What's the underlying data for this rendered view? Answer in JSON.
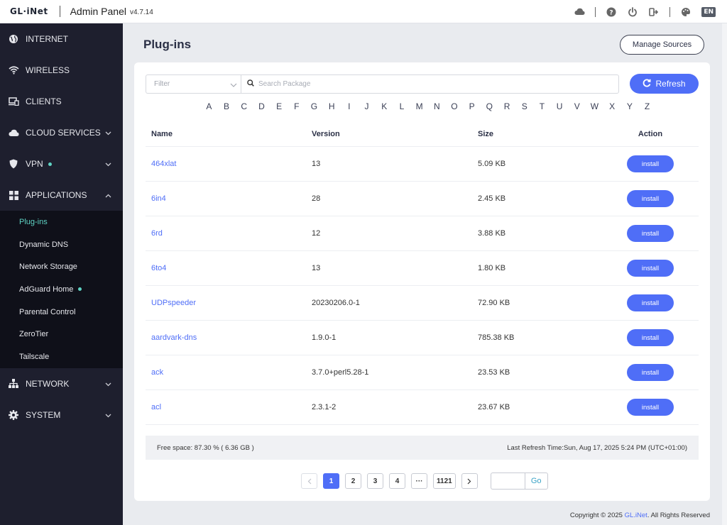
{
  "header": {
    "logo": "GL·iNet",
    "title": "Admin Panel",
    "version": "v4.7.14",
    "lang": "EN"
  },
  "sidebar": {
    "items": [
      {
        "label": "INTERNET",
        "icon": "globe-icon"
      },
      {
        "label": "WIRELESS",
        "icon": "wifi-icon"
      },
      {
        "label": "CLIENTS",
        "icon": "devices-icon"
      },
      {
        "label": "CLOUD SERVICES",
        "icon": "cloud-icon"
      },
      {
        "label": "VPN",
        "icon": "shield-icon"
      },
      {
        "label": "APPLICATIONS",
        "icon": "apps-grid-icon"
      },
      {
        "label": "NETWORK",
        "icon": "network-icon"
      },
      {
        "label": "SYSTEM",
        "icon": "gear-icon"
      }
    ],
    "sub_items": [
      {
        "label": "Plug-ins"
      },
      {
        "label": "Dynamic DNS"
      },
      {
        "label": "Network Storage"
      },
      {
        "label": "AdGuard Home"
      },
      {
        "label": "Parental Control"
      },
      {
        "label": "ZeroTier"
      },
      {
        "label": "Tailscale"
      }
    ]
  },
  "main": {
    "title": "Plug-ins",
    "manage_sources": "Manage Sources",
    "filter_placeholder": "Filter",
    "search_placeholder": "Search Package",
    "refresh_label": "Refresh",
    "alphabet": [
      "A",
      "B",
      "C",
      "D",
      "E",
      "F",
      "G",
      "H",
      "I",
      "J",
      "K",
      "L",
      "M",
      "N",
      "O",
      "P",
      "Q",
      "R",
      "S",
      "T",
      "U",
      "V",
      "W",
      "X",
      "Y",
      "Z"
    ],
    "columns": {
      "name": "Name",
      "version": "Version",
      "size": "Size",
      "action": "Action"
    },
    "install_label": "install",
    "rows": [
      {
        "name": "464xlat",
        "version": "13",
        "size": "5.09 KB"
      },
      {
        "name": "6in4",
        "version": "28",
        "size": "2.45 KB"
      },
      {
        "name": "6rd",
        "version": "12",
        "size": "3.88 KB"
      },
      {
        "name": "6to4",
        "version": "13",
        "size": "1.80 KB"
      },
      {
        "name": "UDPspeeder",
        "version": "20230206.0-1",
        "size": "72.90 KB"
      },
      {
        "name": "aardvark-dns",
        "version": "1.9.0-1",
        "size": "785.38 KB"
      },
      {
        "name": "ack",
        "version": "3.7.0+perl5.28-1",
        "size": "23.53 KB"
      },
      {
        "name": "acl",
        "version": "2.3.1-2",
        "size": "23.67 KB"
      }
    ],
    "free_space": "Free space: 87.30 % ( 6.36 GB )",
    "last_refresh": "Last Refresh Time:Sun, Aug 17, 2025 5:24 PM (UTC+01:00)",
    "pagination": {
      "pages": [
        "1",
        "2",
        "3",
        "4",
        "···",
        "1121"
      ],
      "current": "1",
      "go_label": "Go"
    }
  },
  "footer": {
    "copyright_prefix": "Copyright © 2025 ",
    "brand": "GL.iNet",
    "copyright_suffix": ". All Rights Reserved"
  },
  "colors": {
    "accent": "#4f6ef7",
    "sidebar_bg": "#1e1f2e",
    "active_teal": "#5fd3c4"
  }
}
